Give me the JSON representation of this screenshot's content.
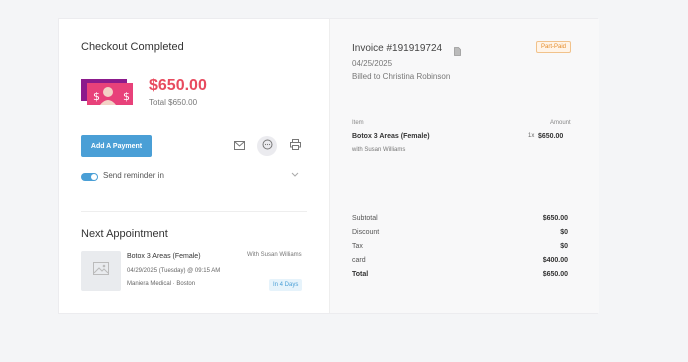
{
  "checkout": {
    "title": "Checkout Completed",
    "amount": "$650.00",
    "total_text": "Total $650.00",
    "add_payment_label": "Add A Payment",
    "reminder_label": "Send reminder in"
  },
  "next_appointment": {
    "title": "Next Appointment",
    "service": "Botox 3 Areas (Female)",
    "datetime": "04/29/2025 (Tuesday) @ 09:15 AM",
    "location": "Maniera Medical · Boston",
    "with": "With Susan Williams",
    "days_badge": "In 4 Days"
  },
  "invoice": {
    "title": "Invoice #191919724",
    "status": "Part-Paid",
    "date": "04/25/2025",
    "billed_to": "Billed to Christina Robinson",
    "col_item": "Item",
    "col_amount": "Amount",
    "line_items": [
      {
        "name": "Botox 3 Areas (Female)",
        "with": "with Susan Williams",
        "qty": "1x",
        "amount": "$650.00"
      }
    ],
    "totals": [
      {
        "label": "Subtotal",
        "value": "$650.00"
      },
      {
        "label": "Discount",
        "value": "$0"
      },
      {
        "label": "Tax",
        "value": "$0"
      },
      {
        "label": "card",
        "value": "$400.00"
      },
      {
        "label": "Total",
        "value": "$650.00"
      }
    ]
  },
  "colors": {
    "accent": "#4a9fd6",
    "amount": "#e84b5f",
    "badge_orange": "#e58c2a"
  },
  "icons": [
    "money-icon",
    "mail-icon",
    "message-icon",
    "print-icon",
    "chevron-down-icon",
    "image-icon",
    "document-icon"
  ]
}
